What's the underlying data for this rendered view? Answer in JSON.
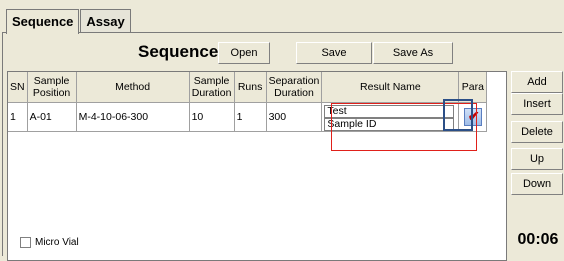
{
  "tabs": [
    {
      "label": "Sequence",
      "active": true
    },
    {
      "label": "Assay",
      "active": false
    }
  ],
  "toolbar": {
    "title": "Sequence",
    "open_label": "Open",
    "save_label": "Save",
    "save_as_label": "Save As"
  },
  "table": {
    "headers": {
      "sn": "SN",
      "sample_position": "Sample Position",
      "method": "Method",
      "sample_duration": "Sample Duration",
      "runs": "Runs",
      "separation_duration": "Separation Duration",
      "result_name": "Result Name",
      "para": "Para"
    },
    "rows": [
      {
        "sn": "1",
        "sample_position": "A-01",
        "method": "M-4-10-06-300",
        "sample_duration": "10",
        "runs": "1",
        "separation_duration": "300",
        "result_name_line1": "Test",
        "result_name_line2": "Sample ID",
        "para_icon": "parameter-check-icon"
      }
    ]
  },
  "side_buttons": {
    "add": "Add",
    "insert": "Insert",
    "delete": "Delete",
    "up": "Up",
    "down": "Down"
  },
  "timer": "00:06",
  "micro_vial": {
    "label": "Micro Vial",
    "checked": false
  },
  "colors": {
    "highlight_red": "#e0201a",
    "highlight_blue": "#2b4f87",
    "background": "#ece9d8"
  }
}
